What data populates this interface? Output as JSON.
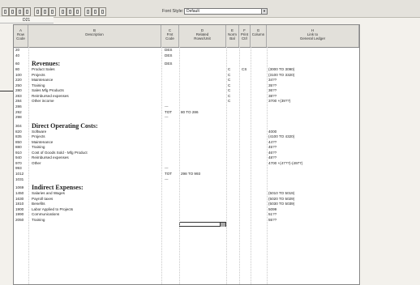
{
  "toolbar": {
    "font_style_label": "Font Style:",
    "font_style_value": "Default"
  },
  "cell_ref": "D21",
  "columns": [
    {
      "letter": "A",
      "title": "Row\nCode"
    },
    {
      "letter": "B",
      "title": "Description"
    },
    {
      "letter": "C",
      "title": "Fmt\nCode"
    },
    {
      "letter": "D",
      "title": "Related\nRows/Unit"
    },
    {
      "letter": "E",
      "title": "Norm\nBal"
    },
    {
      "letter": "F",
      "title": "Print\nCtrl"
    },
    {
      "letter": "G",
      "title": "Column"
    },
    {
      "letter": "H",
      "title": "Link to\nGeneral Ledger"
    }
  ],
  "rows": [
    {
      "code": "20",
      "desc": "",
      "fmt": "DES",
      "rel": "",
      "norm": "",
      "print": "",
      "link": ""
    },
    {
      "code": "40",
      "desc": "",
      "fmt": "DES",
      "rel": "",
      "norm": "",
      "print": "",
      "link": ""
    },
    {
      "code": "60",
      "desc": "Revenues:",
      "fmt": "DES",
      "rel": "",
      "norm": "",
      "print": "",
      "link": "",
      "section": true
    },
    {
      "code": "80",
      "desc": "Product Sales",
      "fmt": "",
      "rel": "",
      "norm": "C",
      "print": "CS",
      "link": "(3000 TO 3090)"
    },
    {
      "code": "100",
      "desc": "Projects",
      "fmt": "",
      "rel": "",
      "norm": "C",
      "print": "",
      "link": "(3100 TO 3320)"
    },
    {
      "code": "220",
      "desc": "Maintenance",
      "fmt": "",
      "rel": "",
      "norm": "C",
      "print": "",
      "link": "34??"
    },
    {
      "code": "250",
      "desc": "Training",
      "fmt": "",
      "rel": "",
      "norm": "C",
      "print": "",
      "link": "35??"
    },
    {
      "code": "280",
      "desc": "Sales Mfg Products",
      "fmt": "",
      "rel": "",
      "norm": "C",
      "print": "",
      "link": "36??"
    },
    {
      "code": "283",
      "desc": "Reimbursed expenses",
      "fmt": "",
      "rel": "",
      "norm": "C",
      "print": "",
      "link": "38??"
    },
    {
      "code": "284",
      "desc": "Other income",
      "fmt": "",
      "rel": "",
      "norm": "C",
      "print": "",
      "link": "3700 +(39??)"
    },
    {
      "code": "286",
      "desc": "",
      "fmt": "---",
      "rel": "",
      "norm": "",
      "print": "",
      "link": ""
    },
    {
      "code": "292",
      "desc": "",
      "fmt": "TOT",
      "rel": "80 TO 286",
      "norm": "",
      "print": "",
      "link": ""
    },
    {
      "code": "298",
      "desc": "",
      "fmt": "---",
      "rel": "",
      "norm": "",
      "print": "",
      "link": ""
    },
    {
      "code": "304",
      "desc": "Direct Operating Costs:",
      "fmt": "",
      "rel": "",
      "norm": "",
      "print": "",
      "link": "",
      "section": true
    },
    {
      "code": "820",
      "desc": "Software",
      "fmt": "",
      "rel": "",
      "norm": "",
      "print": "",
      "link": "4000"
    },
    {
      "code": "835",
      "desc": "Projects",
      "fmt": "",
      "rel": "",
      "norm": "",
      "print": "",
      "link": "(4100 TO 4320)"
    },
    {
      "code": "850",
      "desc": "Maintenance",
      "fmt": "",
      "rel": "",
      "norm": "",
      "print": "",
      "link": "44??"
    },
    {
      "code": "880",
      "desc": "Training",
      "fmt": "",
      "rel": "",
      "norm": "",
      "print": "",
      "link": "45??"
    },
    {
      "code": "910",
      "desc": "Cost of Goods Sold - Mfg Product",
      "fmt": "",
      "rel": "",
      "norm": "",
      "print": "",
      "link": "46??"
    },
    {
      "code": "940",
      "desc": "Reimbursed expenses",
      "fmt": "",
      "rel": "",
      "norm": "",
      "print": "",
      "link": "48??"
    },
    {
      "code": "970",
      "desc": "Other",
      "fmt": "",
      "rel": "",
      "norm": "",
      "print": "",
      "link": "4700 +(47??)-(4977)"
    },
    {
      "code": "993",
      "desc": "",
      "fmt": "---",
      "rel": "",
      "norm": "",
      "print": "",
      "link": ""
    },
    {
      "code": "1012",
      "desc": "",
      "fmt": "TOT",
      "rel": "298 TO 993",
      "norm": "",
      "print": "",
      "link": ""
    },
    {
      "code": "1031",
      "desc": "",
      "fmt": "---",
      "rel": "",
      "norm": "",
      "print": "",
      "link": ""
    },
    {
      "code": "1069",
      "desc": "Indirect Expenses:",
      "fmt": "",
      "rel": "",
      "norm": "",
      "print": "",
      "link": "",
      "section": true
    },
    {
      "code": "1450",
      "desc": "Salaries and Wages",
      "fmt": "",
      "rel": "",
      "norm": "",
      "print": "",
      "link": "(5010 TO 5019)"
    },
    {
      "code": "1630",
      "desc": "Payroll taxes",
      "fmt": "",
      "rel": "",
      "norm": "",
      "print": "",
      "link": "(5020 TO 5029)"
    },
    {
      "code": "1810",
      "desc": "Benefits",
      "fmt": "",
      "rel": "",
      "norm": "",
      "print": "",
      "link": "(5030 TO 5039)"
    },
    {
      "code": "1900",
      "desc": "Labor Applied to Projects",
      "fmt": "",
      "rel": "",
      "norm": "",
      "print": "",
      "link": "5099"
    },
    {
      "code": "1990",
      "desc": "Communications",
      "fmt": "",
      "rel": "",
      "norm": "",
      "print": "",
      "link": "51??"
    },
    {
      "code": "2050",
      "desc": "Training",
      "fmt": "",
      "rel": "",
      "norm": "",
      "print": "",
      "link": "55??"
    }
  ]
}
